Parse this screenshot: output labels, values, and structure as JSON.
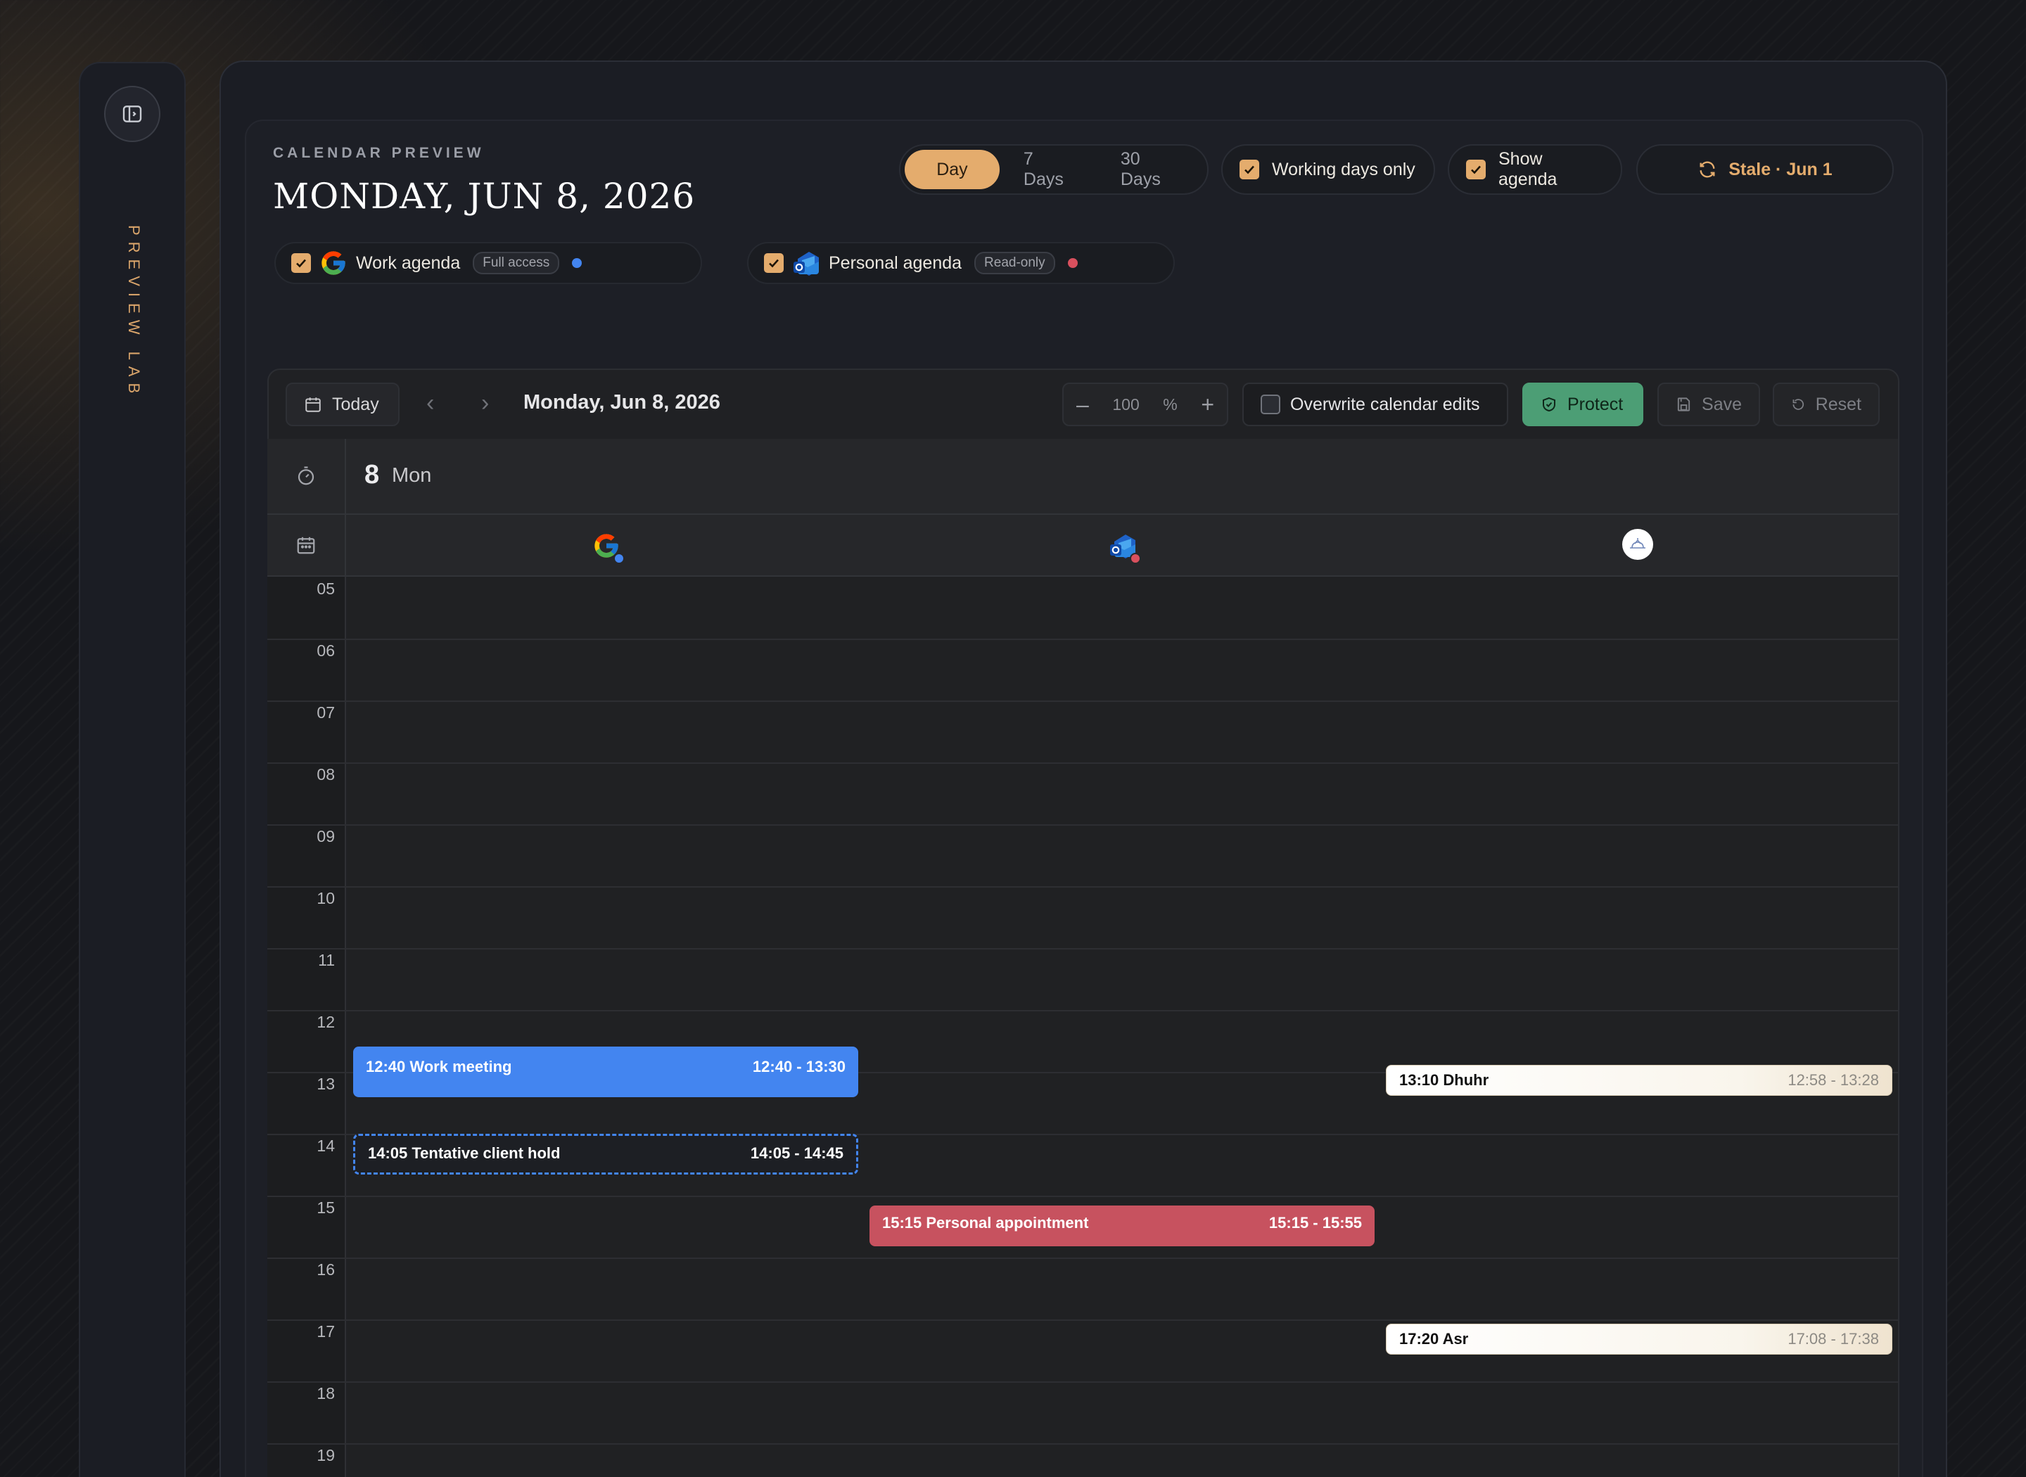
{
  "sidebar": {
    "title": "PREVIEW LAB",
    "toggle_icon": "sidebar-toggle-icon"
  },
  "header": {
    "eyebrow": "CALENDAR PREVIEW",
    "title": "MONDAY, JUN 8, 2026",
    "range_tabs": [
      {
        "label": "Day",
        "active": true
      },
      {
        "label": "7 Days",
        "active": false
      },
      {
        "label": "30 Days",
        "active": false
      }
    ],
    "working_days": {
      "label": "Working days only",
      "checked": true
    },
    "show_agenda": {
      "label": "Show agenda",
      "checked": true
    },
    "sync_status": "Stale · Jun 1"
  },
  "agendas": [
    {
      "label": "Work agenda",
      "badge": "Full access",
      "checked": true,
      "color": "#4385f0",
      "icon": "google-icon"
    },
    {
      "label": "Personal agenda",
      "badge": "Read-only",
      "checked": true,
      "color": "#d9505e",
      "icon": "outlook-icon"
    }
  ],
  "toolbar": {
    "today": "Today",
    "date": "Monday, Jun 8, 2026",
    "zoom_value": "100",
    "zoom_unit": "%",
    "overwrite": {
      "label": "Overwrite calendar edits",
      "checked": false
    },
    "protect": "Protect",
    "save": "Save",
    "reset": "Reset"
  },
  "day_header": {
    "number": "8",
    "name": "Mon"
  },
  "columns": [
    {
      "icon": "google-icon",
      "dot": "#4385f0"
    },
    {
      "icon": "outlook-icon",
      "dot": "#d9505e"
    },
    {
      "icon": "prayer-times-icon"
    }
  ],
  "hours": [
    "05",
    "06",
    "07",
    "08",
    "09",
    "10",
    "11",
    "12",
    "13",
    "14",
    "15",
    "16",
    "17",
    "18",
    "19"
  ],
  "events": [
    {
      "title": "12:40 Work meeting",
      "time": "12:40 - 13:30",
      "style": "solid-blue",
      "column": 0
    },
    {
      "title": "14:05 Tentative client hold",
      "time": "14:05 - 14:45",
      "style": "tentative",
      "column": 0
    },
    {
      "title": "15:15 Personal appointment",
      "time": "15:15 - 15:55",
      "style": "red",
      "column": 1
    },
    {
      "title": "13:10 Dhuhr",
      "time": "12:58 - 13:28",
      "style": "cream",
      "column": 2
    },
    {
      "title": "17:20 Asr",
      "time": "17:08 - 17:38",
      "style": "cream",
      "column": 2
    }
  ],
  "colors": {
    "accent": "#e4ac6d",
    "protect": "#4c9e75",
    "work": "#4385f0",
    "personal": "#c7525f"
  }
}
